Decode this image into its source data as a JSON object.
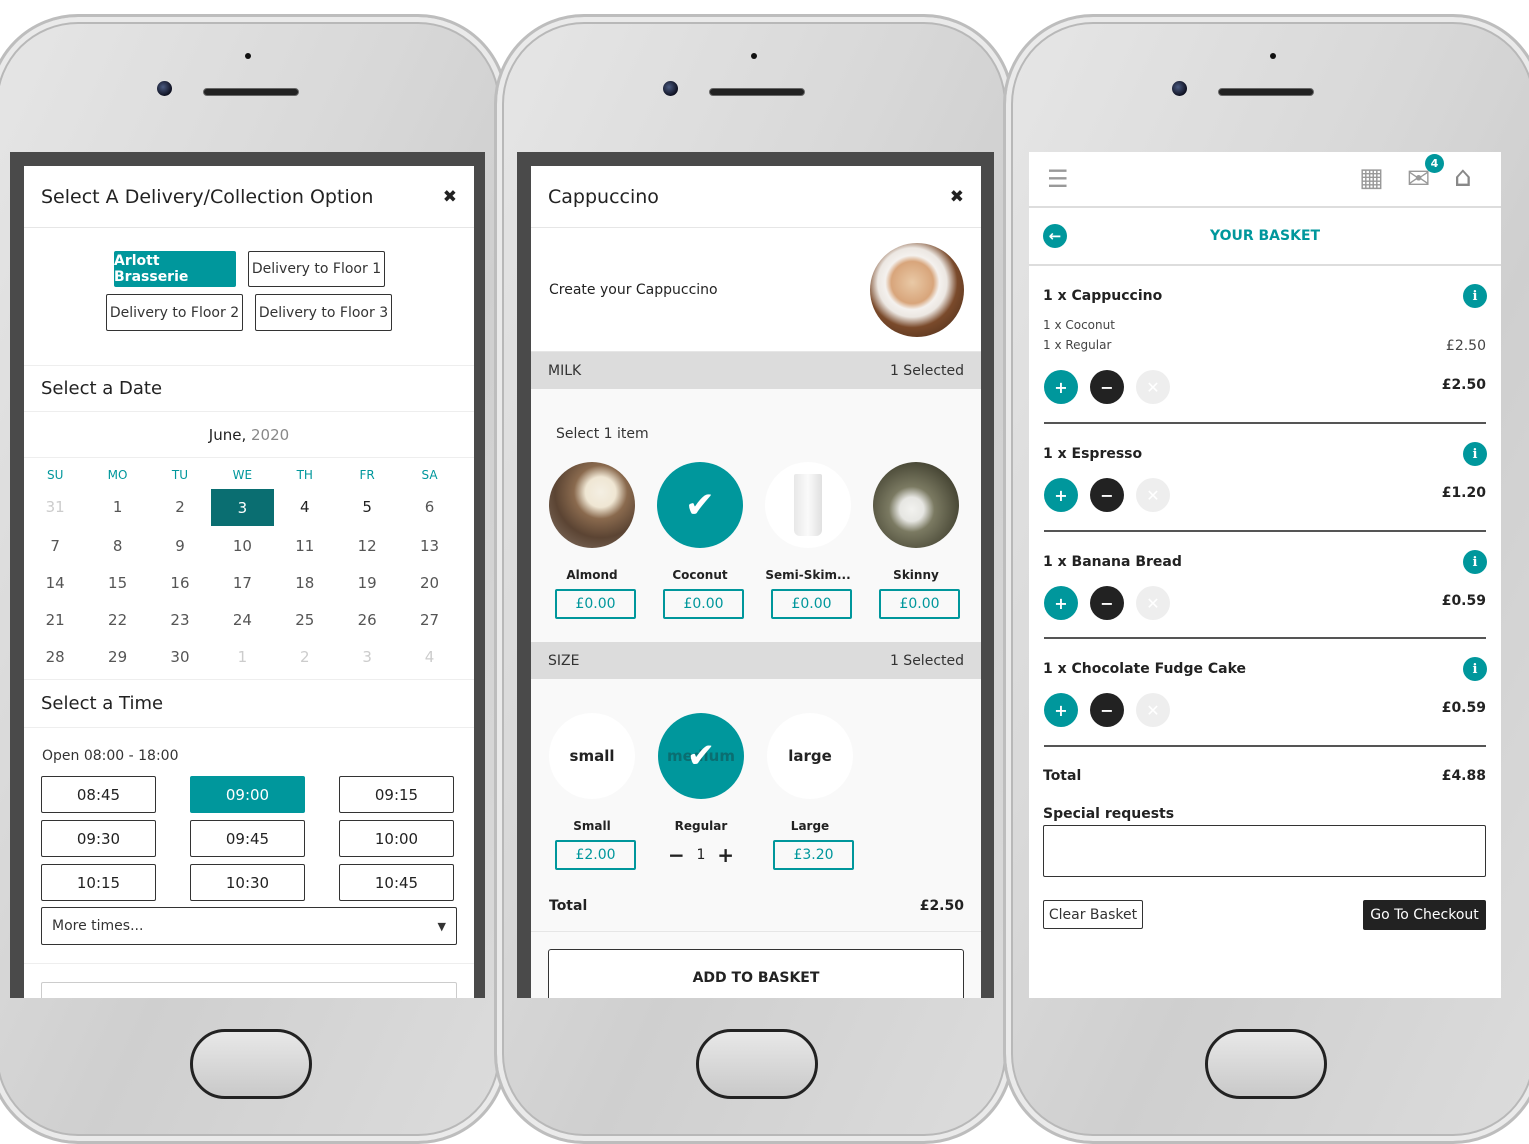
{
  "colors": {
    "teal": "#00979c",
    "dark_teal": "#0a6e71",
    "dark": "#222222"
  },
  "screen1": {
    "title": "Select A Delivery/Collection Option",
    "close_icon": "close-icon",
    "options": [
      "Arlott Brasserie",
      "Delivery to Floor 1",
      "Delivery to Floor 2",
      "Delivery to Floor 3"
    ],
    "selected_option": "Arlott Brasserie",
    "date_heading": "Select a Date",
    "month": "June,",
    "year": "2020",
    "weekdays": [
      "SU",
      "MO",
      "TU",
      "WE",
      "TH",
      "FR",
      "SA"
    ],
    "days": [
      "31",
      "1",
      "2",
      "3",
      "4",
      "5",
      "6",
      "7",
      "8",
      "9",
      "10",
      "11",
      "12",
      "13",
      "14",
      "15",
      "16",
      "17",
      "18",
      "19",
      "20",
      "21",
      "22",
      "23",
      "24",
      "25",
      "26",
      "27",
      "28",
      "29",
      "30",
      "1",
      "2",
      "3",
      "4"
    ],
    "selected_day": "3",
    "time_heading": "Select a Time",
    "open_hours": "Open 08:00 - 18:00",
    "times": [
      "08:45",
      "09:00",
      "09:15",
      "09:30",
      "09:45",
      "10:00",
      "10:15",
      "10:30",
      "10:45"
    ],
    "selected_time": "09:00",
    "more_times": "More times..."
  },
  "screen2": {
    "title": "Cappuccino",
    "subtitle": "Create your Cappuccino",
    "milk_label": "MILK",
    "milk_count": "1 Selected",
    "select_hint": "Select 1 item",
    "milk_options": [
      {
        "name": "Almond",
        "price": "£0.00"
      },
      {
        "name": "Coconut",
        "price": "£0.00"
      },
      {
        "name": "Semi-Skim...",
        "price": "£0.00"
      },
      {
        "name": "Skinny",
        "price": "£0.00"
      }
    ],
    "size_label": "SIZE",
    "size_count": "1 Selected",
    "size_options": [
      {
        "circle": "small",
        "name": "Small",
        "price": "£2.00"
      },
      {
        "circle": "medium",
        "name": "Regular",
        "qty": "1"
      },
      {
        "circle": "large",
        "name": "Large",
        "price": "£3.20"
      }
    ],
    "total_label": "Total",
    "total_value": "£2.50",
    "add_button": "ADD TO BASKET"
  },
  "screen3": {
    "badge_count": "4",
    "heading": "YOUR BASKET",
    "items": [
      {
        "name": "1 x Cappuccino",
        "details": [
          "1 x Coconut",
          "1 x Regular"
        ],
        "detail_price": "£2.50",
        "price": "£2.50"
      },
      {
        "name": "1 x Espresso",
        "price": "£1.20"
      },
      {
        "name": "1 x Banana Bread",
        "price": "£0.59"
      },
      {
        "name": "1 x Chocolate Fudge Cake",
        "price": "£0.59"
      }
    ],
    "total_label": "Total",
    "total_value": "£4.88",
    "special_label": "Special requests",
    "special_value": "",
    "clear_button": "Clear Basket",
    "checkout_button": "Go To Checkout"
  }
}
